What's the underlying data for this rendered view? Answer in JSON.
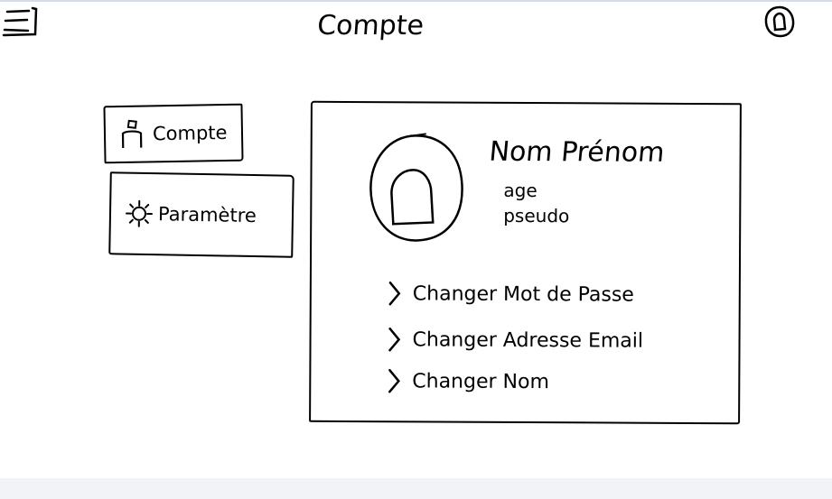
{
  "header": {
    "title": "Compte",
    "menu_icon": "hamburger-menu-icon",
    "profile_icon": "profile-icon"
  },
  "sidebar": {
    "items": [
      {
        "label": "Compte",
        "icon": "user-icon"
      },
      {
        "label": "Paramètre",
        "icon": "gear-icon"
      }
    ]
  },
  "profile": {
    "name": "Nom Prénom",
    "age": "age",
    "pseudo": "pseudo",
    "avatar_icon": "avatar-placeholder-icon"
  },
  "actions": [
    {
      "label": "Changer Mot de Passe",
      "icon": "chevron-right-icon"
    },
    {
      "label": "Changer Adresse Email",
      "icon": "chevron-right-icon"
    },
    {
      "label": "Changer Nom",
      "icon": "chevron-right-icon"
    }
  ]
}
